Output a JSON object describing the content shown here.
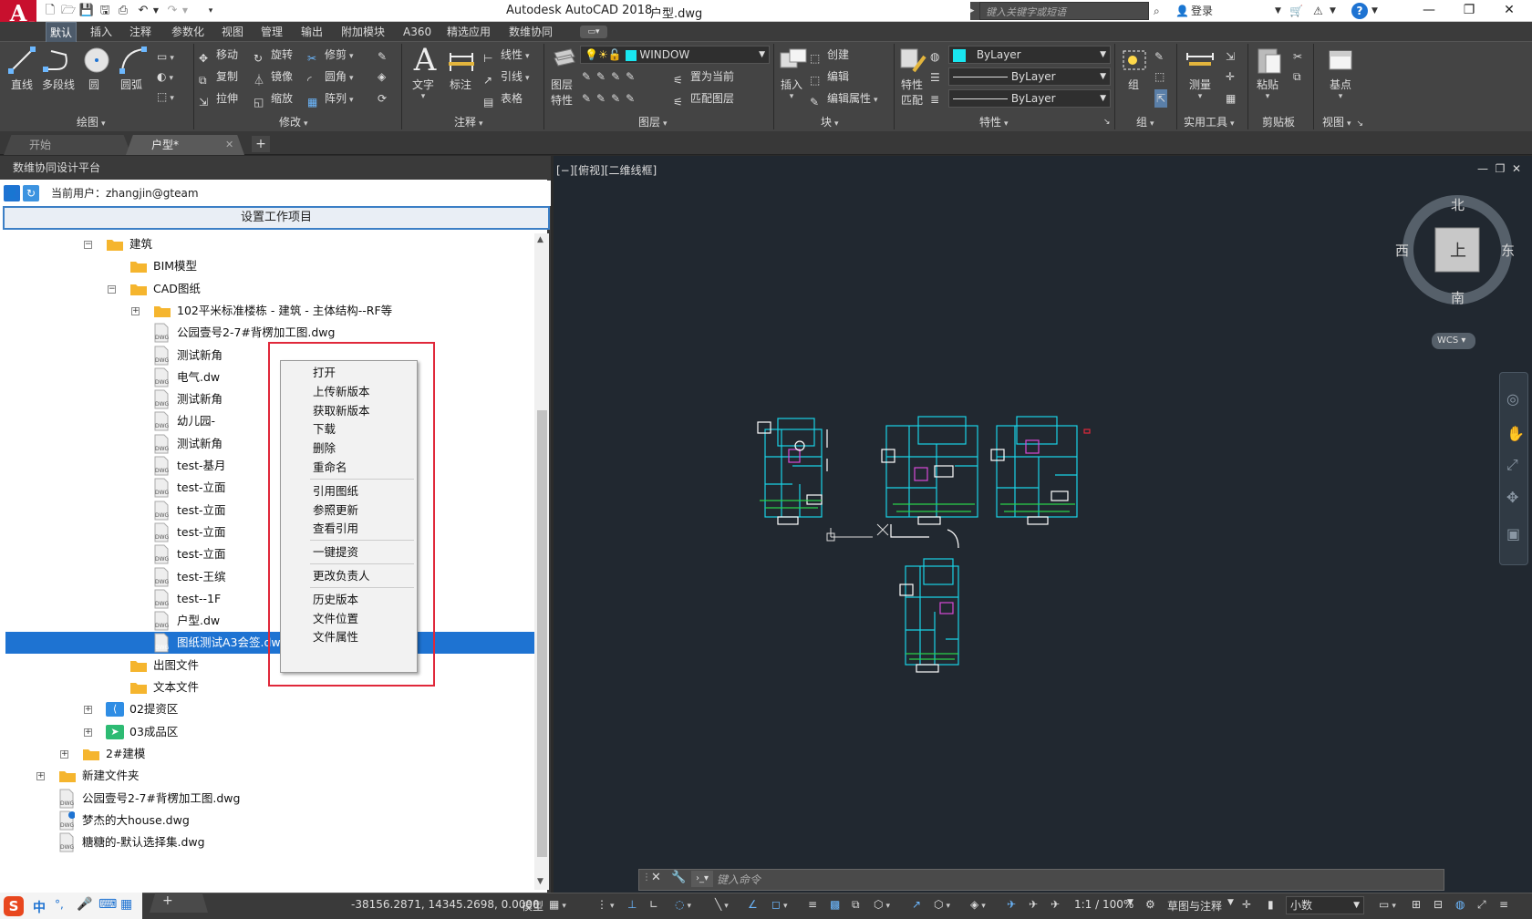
{
  "titlebar": {
    "app_title": "Autodesk AutoCAD 2018",
    "filename": "户型.dwg",
    "search_placeholder": "键入关键字或短语",
    "login": "登录"
  },
  "menu_tabs": [
    "默认",
    "插入",
    "注释",
    "参数化",
    "视图",
    "管理",
    "输出",
    "附加模块",
    "A360",
    "精选应用",
    "数维协同"
  ],
  "ribbon": {
    "draw": {
      "line": "直线",
      "polyline": "多段线",
      "circle": "圆",
      "arc": "圆弧",
      "footer": "绘图"
    },
    "modify": {
      "move": "移动",
      "rotate": "旋转",
      "trim": "修剪",
      "copy": "复制",
      "mirror": "镜像",
      "fillet": "圆角",
      "stretch": "拉伸",
      "scale": "缩放",
      "array": "阵列",
      "footer": "修改"
    },
    "annotation": {
      "text": "文字",
      "dimension": "标注",
      "linear": "线性",
      "leader": "引线",
      "table": "表格",
      "footer": "注释"
    },
    "layers": {
      "props_line1": "图层",
      "props_line2": "特性",
      "current_layer": "WINDOW",
      "set_current": "置为当前",
      "match_layer": "匹配图层",
      "footer": "图层"
    },
    "block": {
      "insert": "插入",
      "create": "创建",
      "edit": "编辑",
      "edit_attr": "编辑属性",
      "footer": "块"
    },
    "properties": {
      "match_line1": "特性",
      "match_line2": "匹配",
      "color": "ByLayer",
      "linetype": "ByLayer",
      "lineweight": "ByLayer",
      "footer": "特性"
    },
    "group": {
      "label": "组",
      "footer": "组"
    },
    "utilities": {
      "measure": "测量",
      "footer": "实用工具"
    },
    "clipboard": {
      "paste": "粘贴",
      "footer": "剪贴板"
    },
    "view": {
      "base": "基点",
      "footer": "视图"
    }
  },
  "doc_tabs": {
    "start": "开始",
    "current": "户型*"
  },
  "palette": {
    "title": "数维协同设计平台",
    "current_user_label": "当前用户：",
    "current_user": "zhangjin@gteam",
    "set_project_button": "设置工作项目"
  },
  "tree": [
    {
      "indent": 1,
      "type": "folder",
      "expander": "−",
      "label": "建筑"
    },
    {
      "indent": 2,
      "type": "folder",
      "expander": "",
      "label": "BIM模型"
    },
    {
      "indent": 2,
      "type": "folder",
      "expander": "−",
      "label": "CAD图纸"
    },
    {
      "indent": 3,
      "type": "folder",
      "expander": "+",
      "label": "102平米标准楼栋 - 建筑 - 主体结构--RF等"
    },
    {
      "indent": 3,
      "type": "dwg",
      "expander": "",
      "label": "公园壹号2-7#背楞加工图.dwg"
    },
    {
      "indent": 3,
      "type": "dwg",
      "expander": "",
      "label": "测试新角"
    },
    {
      "indent": 3,
      "type": "dwg",
      "expander": "",
      "label": "电气.dw"
    },
    {
      "indent": 3,
      "type": "dwg",
      "expander": "",
      "label": "测试新角"
    },
    {
      "indent": 3,
      "type": "dwg",
      "expander": "",
      "label": "幼儿园-"
    },
    {
      "indent": 3,
      "type": "dwg",
      "expander": "",
      "label": "测试新角"
    },
    {
      "indent": 3,
      "type": "dwg",
      "expander": "",
      "label": "test-基月"
    },
    {
      "indent": 3,
      "type": "dwg",
      "expander": "",
      "label": "test-立面"
    },
    {
      "indent": 3,
      "type": "dwg",
      "expander": "",
      "label": "test-立面"
    },
    {
      "indent": 3,
      "type": "dwg",
      "expander": "",
      "label": "test-立面"
    },
    {
      "indent": 3,
      "type": "dwg",
      "expander": "",
      "label": "test-立面"
    },
    {
      "indent": 3,
      "type": "dwg",
      "expander": "",
      "label": "test-王缤"
    },
    {
      "indent": 3,
      "type": "dwg",
      "expander": "",
      "label": "test--1F"
    },
    {
      "indent": 3,
      "type": "dwg",
      "expander": "",
      "label": "户型.dw"
    },
    {
      "indent": 3,
      "type": "dwg",
      "expander": "",
      "label": "图纸测试A3会签.dwg",
      "selected": true
    },
    {
      "indent": 2,
      "type": "folder",
      "expander": "",
      "label": "出图文件"
    },
    {
      "indent": 2,
      "type": "folder",
      "expander": "",
      "label": "文本文件"
    },
    {
      "indent": 1,
      "type": "share",
      "expander": "+",
      "label": "02提资区"
    },
    {
      "indent": 1,
      "type": "send",
      "expander": "+",
      "label": "03成品区"
    },
    {
      "indent": 0,
      "type": "folder",
      "expander": "+",
      "label": "2#建模"
    },
    {
      "indent": -1,
      "type": "folder",
      "expander": "+",
      "label": "新建文件夹"
    },
    {
      "indent": -1,
      "type": "dwg",
      "expander": "",
      "label": "公园壹号2-7#背楞加工图.dwg"
    },
    {
      "indent": -1,
      "type": "dwg2",
      "expander": "",
      "label": "梦杰的大house.dwg"
    },
    {
      "indent": -1,
      "type": "dwg",
      "expander": "",
      "label": "糖糖的-默认选择集.dwg"
    }
  ],
  "context_menu": [
    {
      "label": "打开"
    },
    {
      "label": "上传新版本"
    },
    {
      "label": "获取新版本"
    },
    {
      "label": "下载"
    },
    {
      "label": "删除"
    },
    {
      "label": "重命名"
    },
    {
      "sep": true
    },
    {
      "label": "引用图纸"
    },
    {
      "label": "参照更新"
    },
    {
      "label": "查看引用"
    },
    {
      "sep": true
    },
    {
      "label": "一键提资"
    },
    {
      "sep": true
    },
    {
      "label": "更改负责人"
    },
    {
      "sep": true
    },
    {
      "label": "历史版本"
    },
    {
      "label": "文件位置"
    },
    {
      "label": "文件属性"
    }
  ],
  "viewport": {
    "label": "[−][俯视][二维线框]",
    "viewcube": {
      "north": "北",
      "south": "南",
      "east": "东",
      "west": "西",
      "top": "上",
      "wcs": "WCS"
    }
  },
  "command": {
    "placeholder": "键入命令"
  },
  "statusbar": {
    "coords": "-38156.2871, 14345.2698, 0.0000",
    "model": "模型",
    "scale": "1:1 / 100%",
    "workspace": "草图与注释",
    "units": "小数"
  },
  "ime": {
    "lang": "中"
  },
  "colors": {
    "accent": "#1e73d2",
    "highlight": "#e0283a",
    "canvas": "#212830",
    "drawing": "#19d3e6"
  }
}
